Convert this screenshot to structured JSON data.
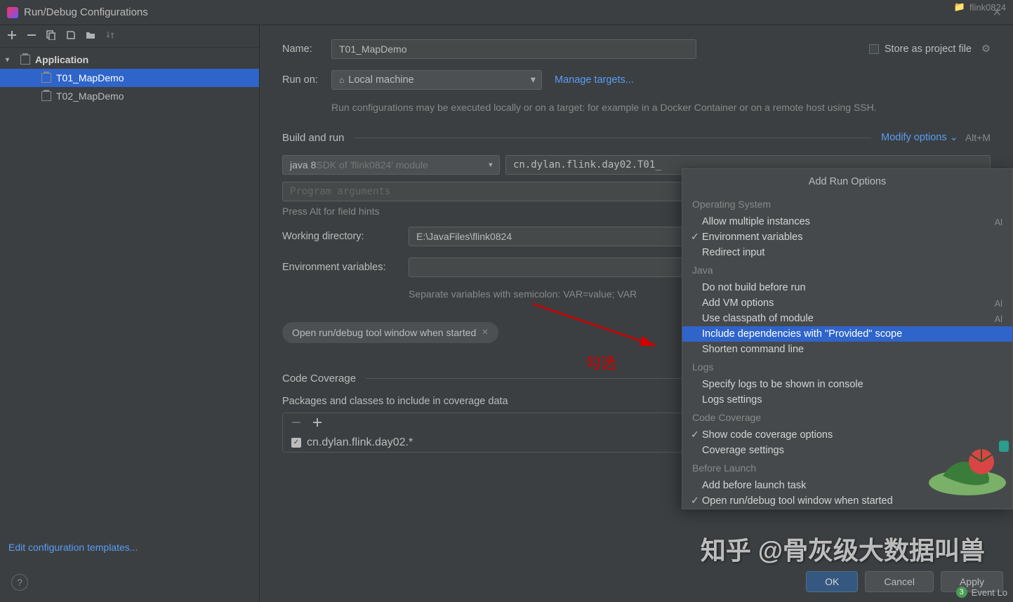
{
  "title": "Run/Debug Configurations",
  "background_tab": "flink0824",
  "sidebar": {
    "root_label": "Application",
    "items": [
      {
        "label": "T01_MapDemo"
      },
      {
        "label": "T02_MapDemo"
      }
    ],
    "edit_templates": "Edit configuration templates..."
  },
  "form": {
    "name_label": "Name:",
    "name_value": "T01_MapDemo",
    "store_as_project": "Store as project file",
    "run_on_label": "Run on:",
    "run_on_value": "Local machine",
    "manage_targets": "Manage targets...",
    "run_on_hint": "Run configurations may be executed locally or on a target: for example in a Docker Container or on a remote host using SSH.",
    "build_and_run": "Build and run",
    "modify_options": "Modify options",
    "modify_shortcut": "Alt+M",
    "sdk_java": "java 8 ",
    "sdk_module": "SDK of 'flink0824' module",
    "main_class": "cn.dylan.flink.day02.T01_",
    "program_args_placeholder": "Program arguments",
    "field_hints": "Press Alt for field hints",
    "working_dir_label": "Working directory:",
    "working_dir_value": "E:\\JavaFiles\\flink0824",
    "env_label": "Environment variables:",
    "env_hint": "Separate variables with semicolon: VAR=value; VAR",
    "chip_label": "Open run/debug tool window when started",
    "code_coverage": "Code Coverage",
    "packages_label": "Packages and classes to include in coverage data",
    "coverage_item": "cn.dylan.flink.day02.*"
  },
  "popup": {
    "title": "Add Run Options",
    "groups": [
      {
        "header": "Operating System",
        "items": [
          {
            "label": "Allow multiple instances",
            "shortcut": "Al"
          },
          {
            "label": "Environment variables",
            "checked": true
          },
          {
            "label": "Redirect input"
          }
        ]
      },
      {
        "header": "Java",
        "items": [
          {
            "label": "Do not build before run"
          },
          {
            "label": "Add VM options",
            "shortcut": "Al"
          },
          {
            "label": "Use classpath of module",
            "shortcut": "Al"
          },
          {
            "label": "Include dependencies with \"Provided\" scope",
            "highlighted": true
          },
          {
            "label": "Shorten command line"
          }
        ]
      },
      {
        "header": "Logs",
        "items": [
          {
            "label": "Specify logs to be shown in console"
          },
          {
            "label": "Logs settings"
          }
        ]
      },
      {
        "header": "Code Coverage",
        "items": [
          {
            "label": "Show code coverage options",
            "checked": true
          },
          {
            "label": "Coverage settings"
          }
        ]
      },
      {
        "header": "Before Launch",
        "items": [
          {
            "label": "Add before launch task"
          },
          {
            "label": "Open run/debug tool window when started",
            "checked": true
          }
        ]
      }
    ]
  },
  "buttons": {
    "ok": "OK",
    "cancel": "Cancel",
    "apply": "Apply"
  },
  "annotation_text": "勾选",
  "watermark": "知乎 @骨灰级大数据叫兽",
  "status_bar": {
    "badge": "3",
    "event_log": "Event Lo"
  }
}
